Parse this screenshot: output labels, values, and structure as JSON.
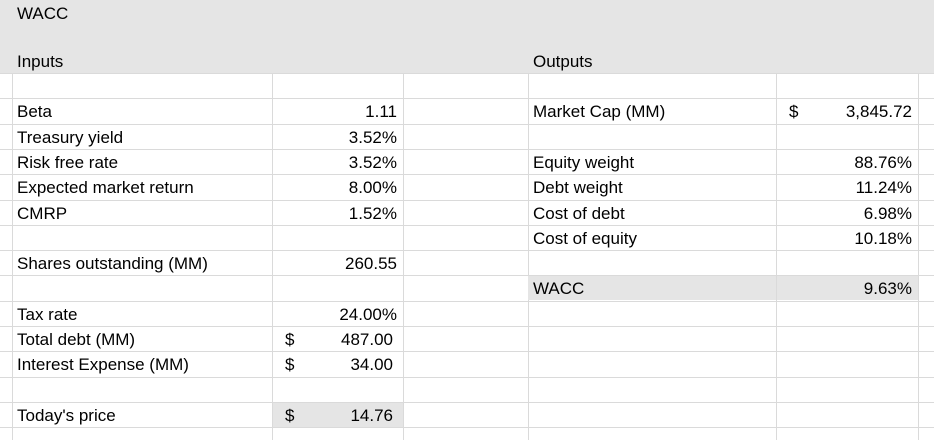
{
  "title": "WACC",
  "inputs_header": "Inputs",
  "outputs_header": "Outputs",
  "inputs": [
    {
      "row": 1,
      "label": "Beta",
      "value": "1.11"
    },
    {
      "row": 2,
      "label": "Treasury yield",
      "value": "3.52%"
    },
    {
      "row": 3,
      "label": "Risk free rate",
      "value": "3.52%"
    },
    {
      "row": 4,
      "label": "Expected market return",
      "value": "8.00%"
    },
    {
      "row": 5,
      "label": "CMRP",
      "value": "1.52%"
    },
    {
      "row": 7,
      "label": "Shares outstanding (MM)",
      "value": "260.55"
    },
    {
      "row": 9,
      "label": "Tax rate",
      "value": "24.00%"
    },
    {
      "row": 10,
      "label": "Total debt (MM)",
      "value": "487.00",
      "currency": "$"
    },
    {
      "row": 11,
      "label": "Interest Expense (MM)",
      "value": "34.00",
      "currency": "$"
    },
    {
      "row": 13,
      "label": "Today's price",
      "value": "14.76",
      "currency": "$",
      "highlight": true
    }
  ],
  "outputs": [
    {
      "row": 1,
      "label": "Market Cap (MM)",
      "value": "3,845.72",
      "currency": "$"
    },
    {
      "row": 3,
      "label": "Equity weight",
      "value": "88.76%"
    },
    {
      "row": 4,
      "label": "Debt weight",
      "value": "11.24%"
    },
    {
      "row": 5,
      "label": "Cost of debt",
      "value": "6.98%"
    },
    {
      "row": 6,
      "label": "Cost of equity",
      "value": "10.18%"
    },
    {
      "row": 8,
      "label": "WACC",
      "value": "9.63%",
      "highlight": true
    }
  ]
}
